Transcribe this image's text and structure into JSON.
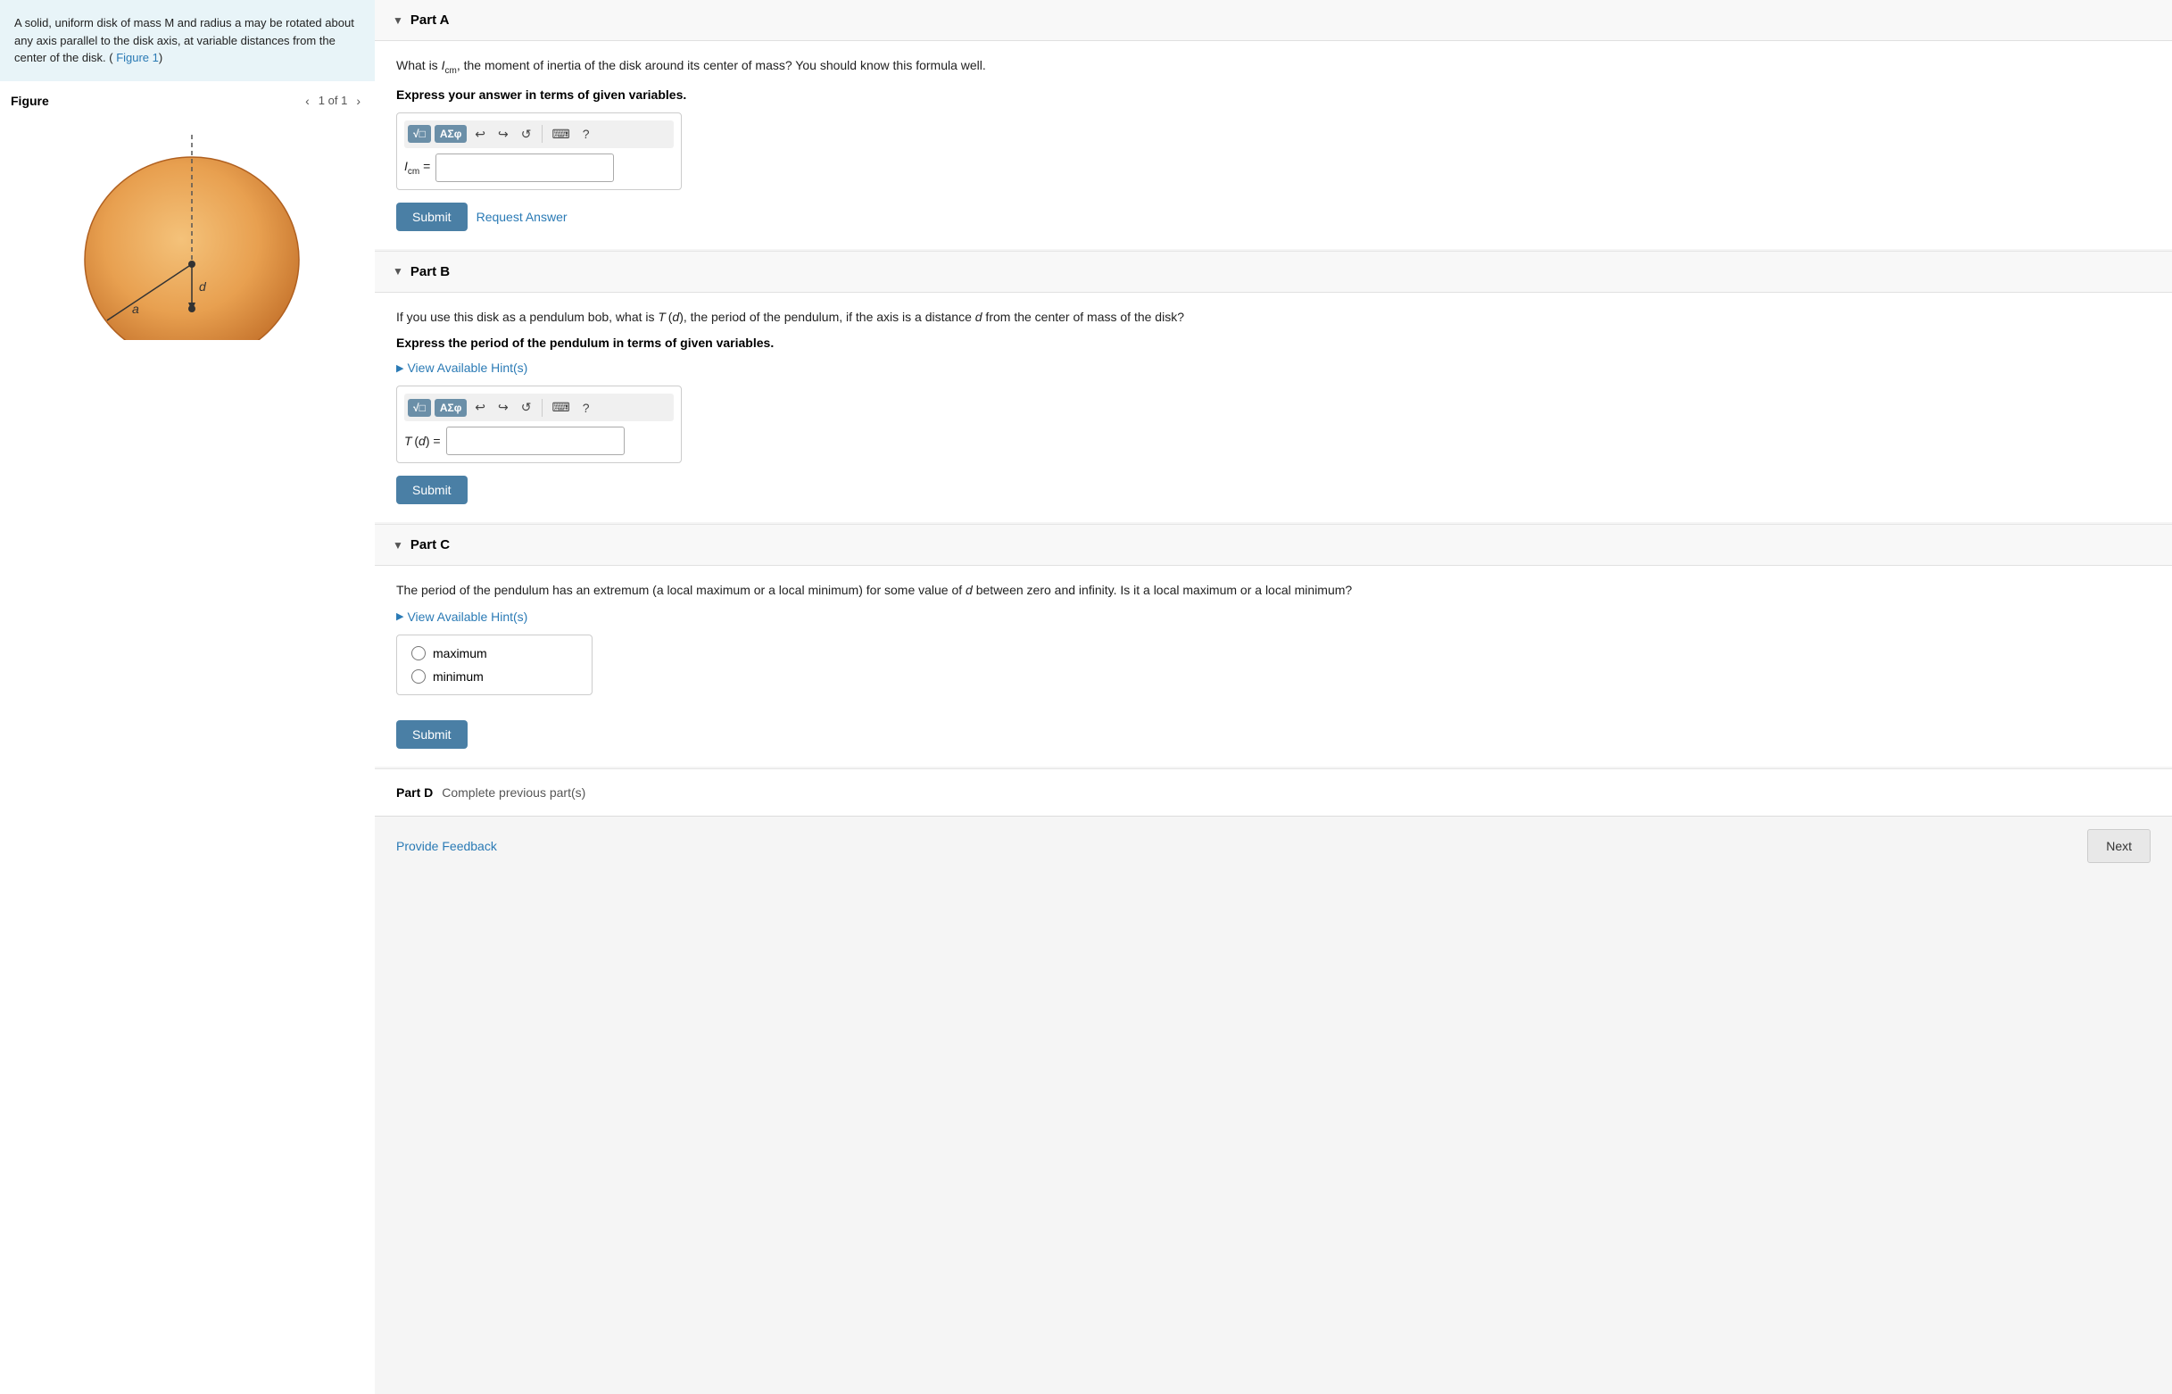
{
  "left": {
    "problem_statement": "A solid, uniform disk of mass M and radius a may be rotated about any axis parallel to the disk axis, at variable distances from the center of the disk. (",
    "figure_link": "Figure 1",
    "figure_title": "Figure",
    "figure_nav": "1 of 1"
  },
  "parts": {
    "partA": {
      "title": "Part A",
      "question": "What is I_cm, the moment of inertia of the disk around its center of mass? You should know this formula well.",
      "instruction": "Express your answer in terms of given variables.",
      "label": "I_cm =",
      "submit_label": "Submit",
      "request_label": "Request Answer"
    },
    "partB": {
      "title": "Part B",
      "question": "If you use this disk as a pendulum bob, what is T(d), the period of the pendulum, if the axis is a distance d from the center of mass of the disk?",
      "instruction": "Express the period of the pendulum in terms of given variables.",
      "hint_label": "View Available Hint(s)",
      "label": "T(d) =",
      "submit_label": "Submit"
    },
    "partC": {
      "title": "Part C",
      "question": "The period of the pendulum has an extremum (a local maximum or a local minimum) for some value of d between zero and infinity. Is it a local maximum or a local minimum?",
      "hint_label": "View Available Hint(s)",
      "options": [
        "maximum",
        "minimum"
      ],
      "submit_label": "Submit"
    },
    "partD": {
      "title": "Part D",
      "text": "Complete previous part(s)"
    }
  },
  "bottom": {
    "feedback_label": "Provide Feedback",
    "next_label": "Next"
  },
  "toolbar": {
    "btn1": "√□",
    "btn2": "ΑΣφ",
    "undo": "↩",
    "redo": "↪",
    "reset": "↺",
    "keyboard": "⌨",
    "help": "?"
  }
}
